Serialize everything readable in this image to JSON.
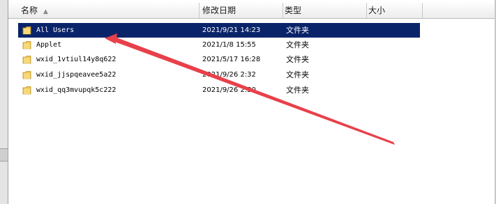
{
  "columns": {
    "name": "名称",
    "date": "修改日期",
    "type": "类型",
    "size": "大小"
  },
  "rows": [
    {
      "name": "All Users",
      "date": "2021/9/21 14:23",
      "type": "文件夹",
      "selected": true
    },
    {
      "name": "Applet",
      "date": "2021/1/8 15:55",
      "type": "文件夹"
    },
    {
      "name": "wxid_1vtiul14y8q622",
      "date": "2021/5/17 16:28",
      "type": "文件夹"
    },
    {
      "name": "wxid_jjspqeavee5a22",
      "date": "2021/9/26 2:32",
      "type": "文件夹"
    },
    {
      "name": "wxid_qq3mvupqk5c222",
      "date": "2021/9/26 2:30",
      "type": "文件夹"
    }
  ],
  "colors": {
    "selection": "#0a246a",
    "annotation_arrow": "#e8404a",
    "folder_icon": "#f1c54e"
  },
  "icons": {
    "row_icon": "folder-icon",
    "sort": "sort-up-icon"
  }
}
